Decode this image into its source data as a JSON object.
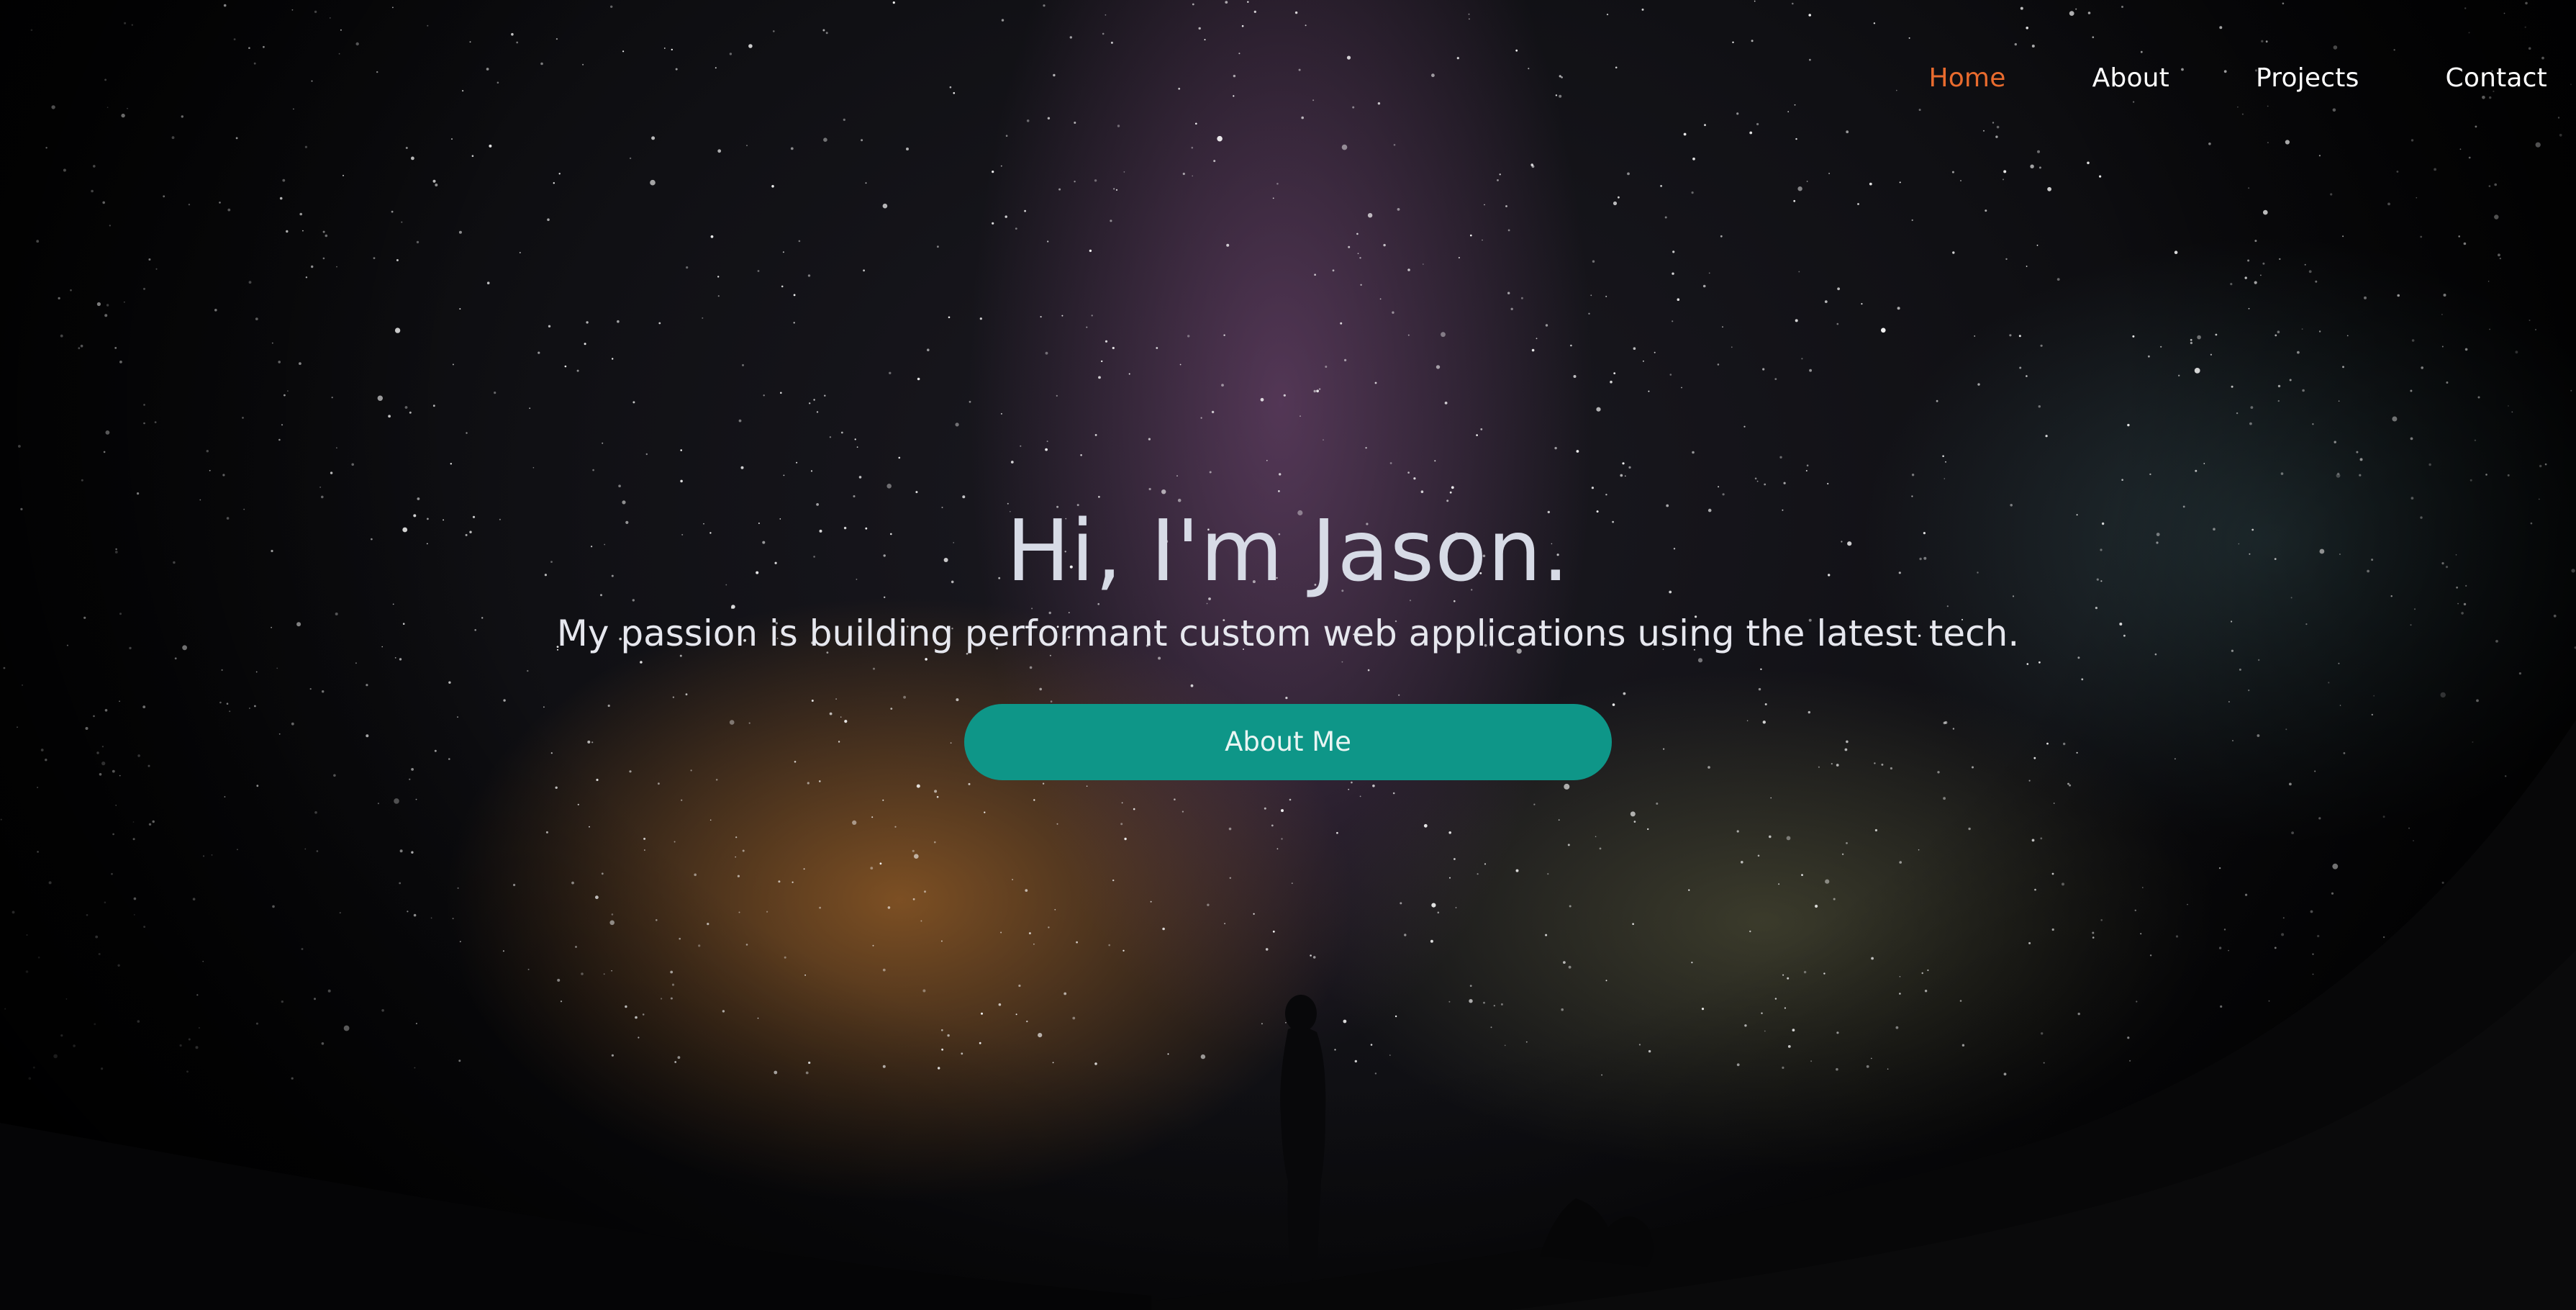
{
  "nav": {
    "items": [
      {
        "label": "Home",
        "active": true
      },
      {
        "label": "About",
        "active": false
      },
      {
        "label": "Projects",
        "active": false
      },
      {
        "label": "Contact",
        "active": false
      }
    ],
    "active_color": "#e96b2e"
  },
  "hero": {
    "title": "Hi, I'm Jason.",
    "subtitle": "My passion is building performant custom web applications using the latest tech.",
    "cta_label": "About Me",
    "cta_color": "#0e9688"
  },
  "background": {
    "description_icon": "night-sky-milky-way-silhouette"
  }
}
